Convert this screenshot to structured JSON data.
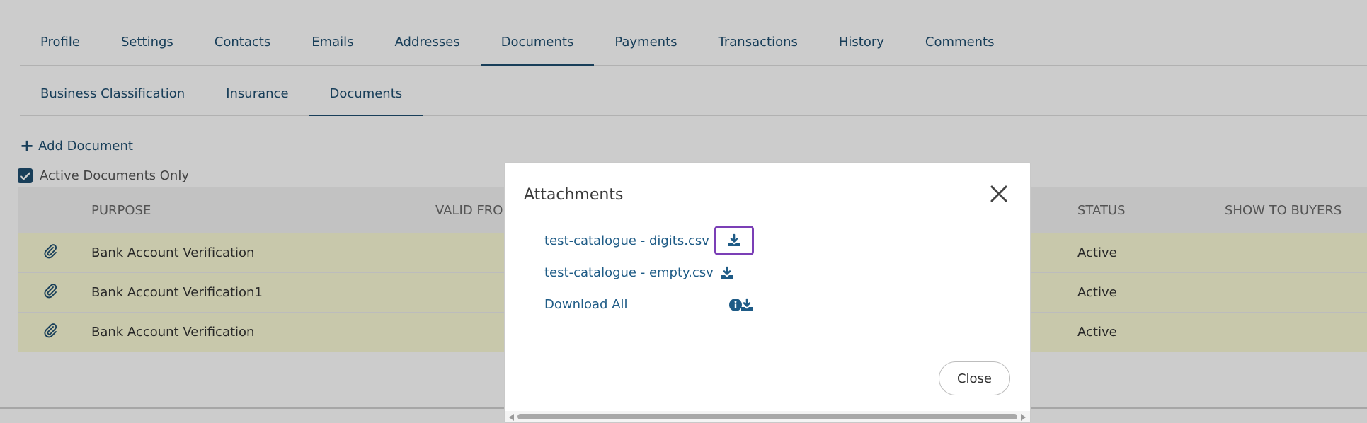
{
  "primary_tabs": [
    {
      "label": "Profile",
      "active": false
    },
    {
      "label": "Settings",
      "active": false
    },
    {
      "label": "Contacts",
      "active": false
    },
    {
      "label": "Emails",
      "active": false
    },
    {
      "label": "Addresses",
      "active": false
    },
    {
      "label": "Documents",
      "active": true
    },
    {
      "label": "Payments",
      "active": false
    },
    {
      "label": "Transactions",
      "active": false
    },
    {
      "label": "History",
      "active": false
    },
    {
      "label": "Comments",
      "active": false
    }
  ],
  "secondary_tabs": [
    {
      "label": "Business Classification",
      "active": false
    },
    {
      "label": "Insurance",
      "active": false
    },
    {
      "label": "Documents",
      "active": true
    }
  ],
  "add_document_label": "Add Document",
  "active_documents_only": {
    "label": "Active Documents Only",
    "checked": true
  },
  "grid": {
    "headers": {
      "purpose": "PURPOSE",
      "valid_from": "VALID FRO",
      "status": "STATUS",
      "show_to_buyers": "SHOW TO BUYERS"
    },
    "rows": [
      {
        "purpose": "Bank Account Verification",
        "status": "Active"
      },
      {
        "purpose": "Bank Account Verification1",
        "status": "Active"
      },
      {
        "purpose": "Bank Account Verification",
        "status": "Active"
      }
    ]
  },
  "modal": {
    "title": "Attachments",
    "attachments": [
      {
        "name": "test-catalogue - digits.csv"
      },
      {
        "name": "test-catalogue - empty.csv"
      }
    ],
    "download_all_label": "Download All",
    "close_label": "Close"
  },
  "colors": {
    "accent": "#1e4e70",
    "link": "#1e5b86",
    "row_highlight": "#fbfbd6",
    "focus_ring": "#7b3fb6"
  }
}
